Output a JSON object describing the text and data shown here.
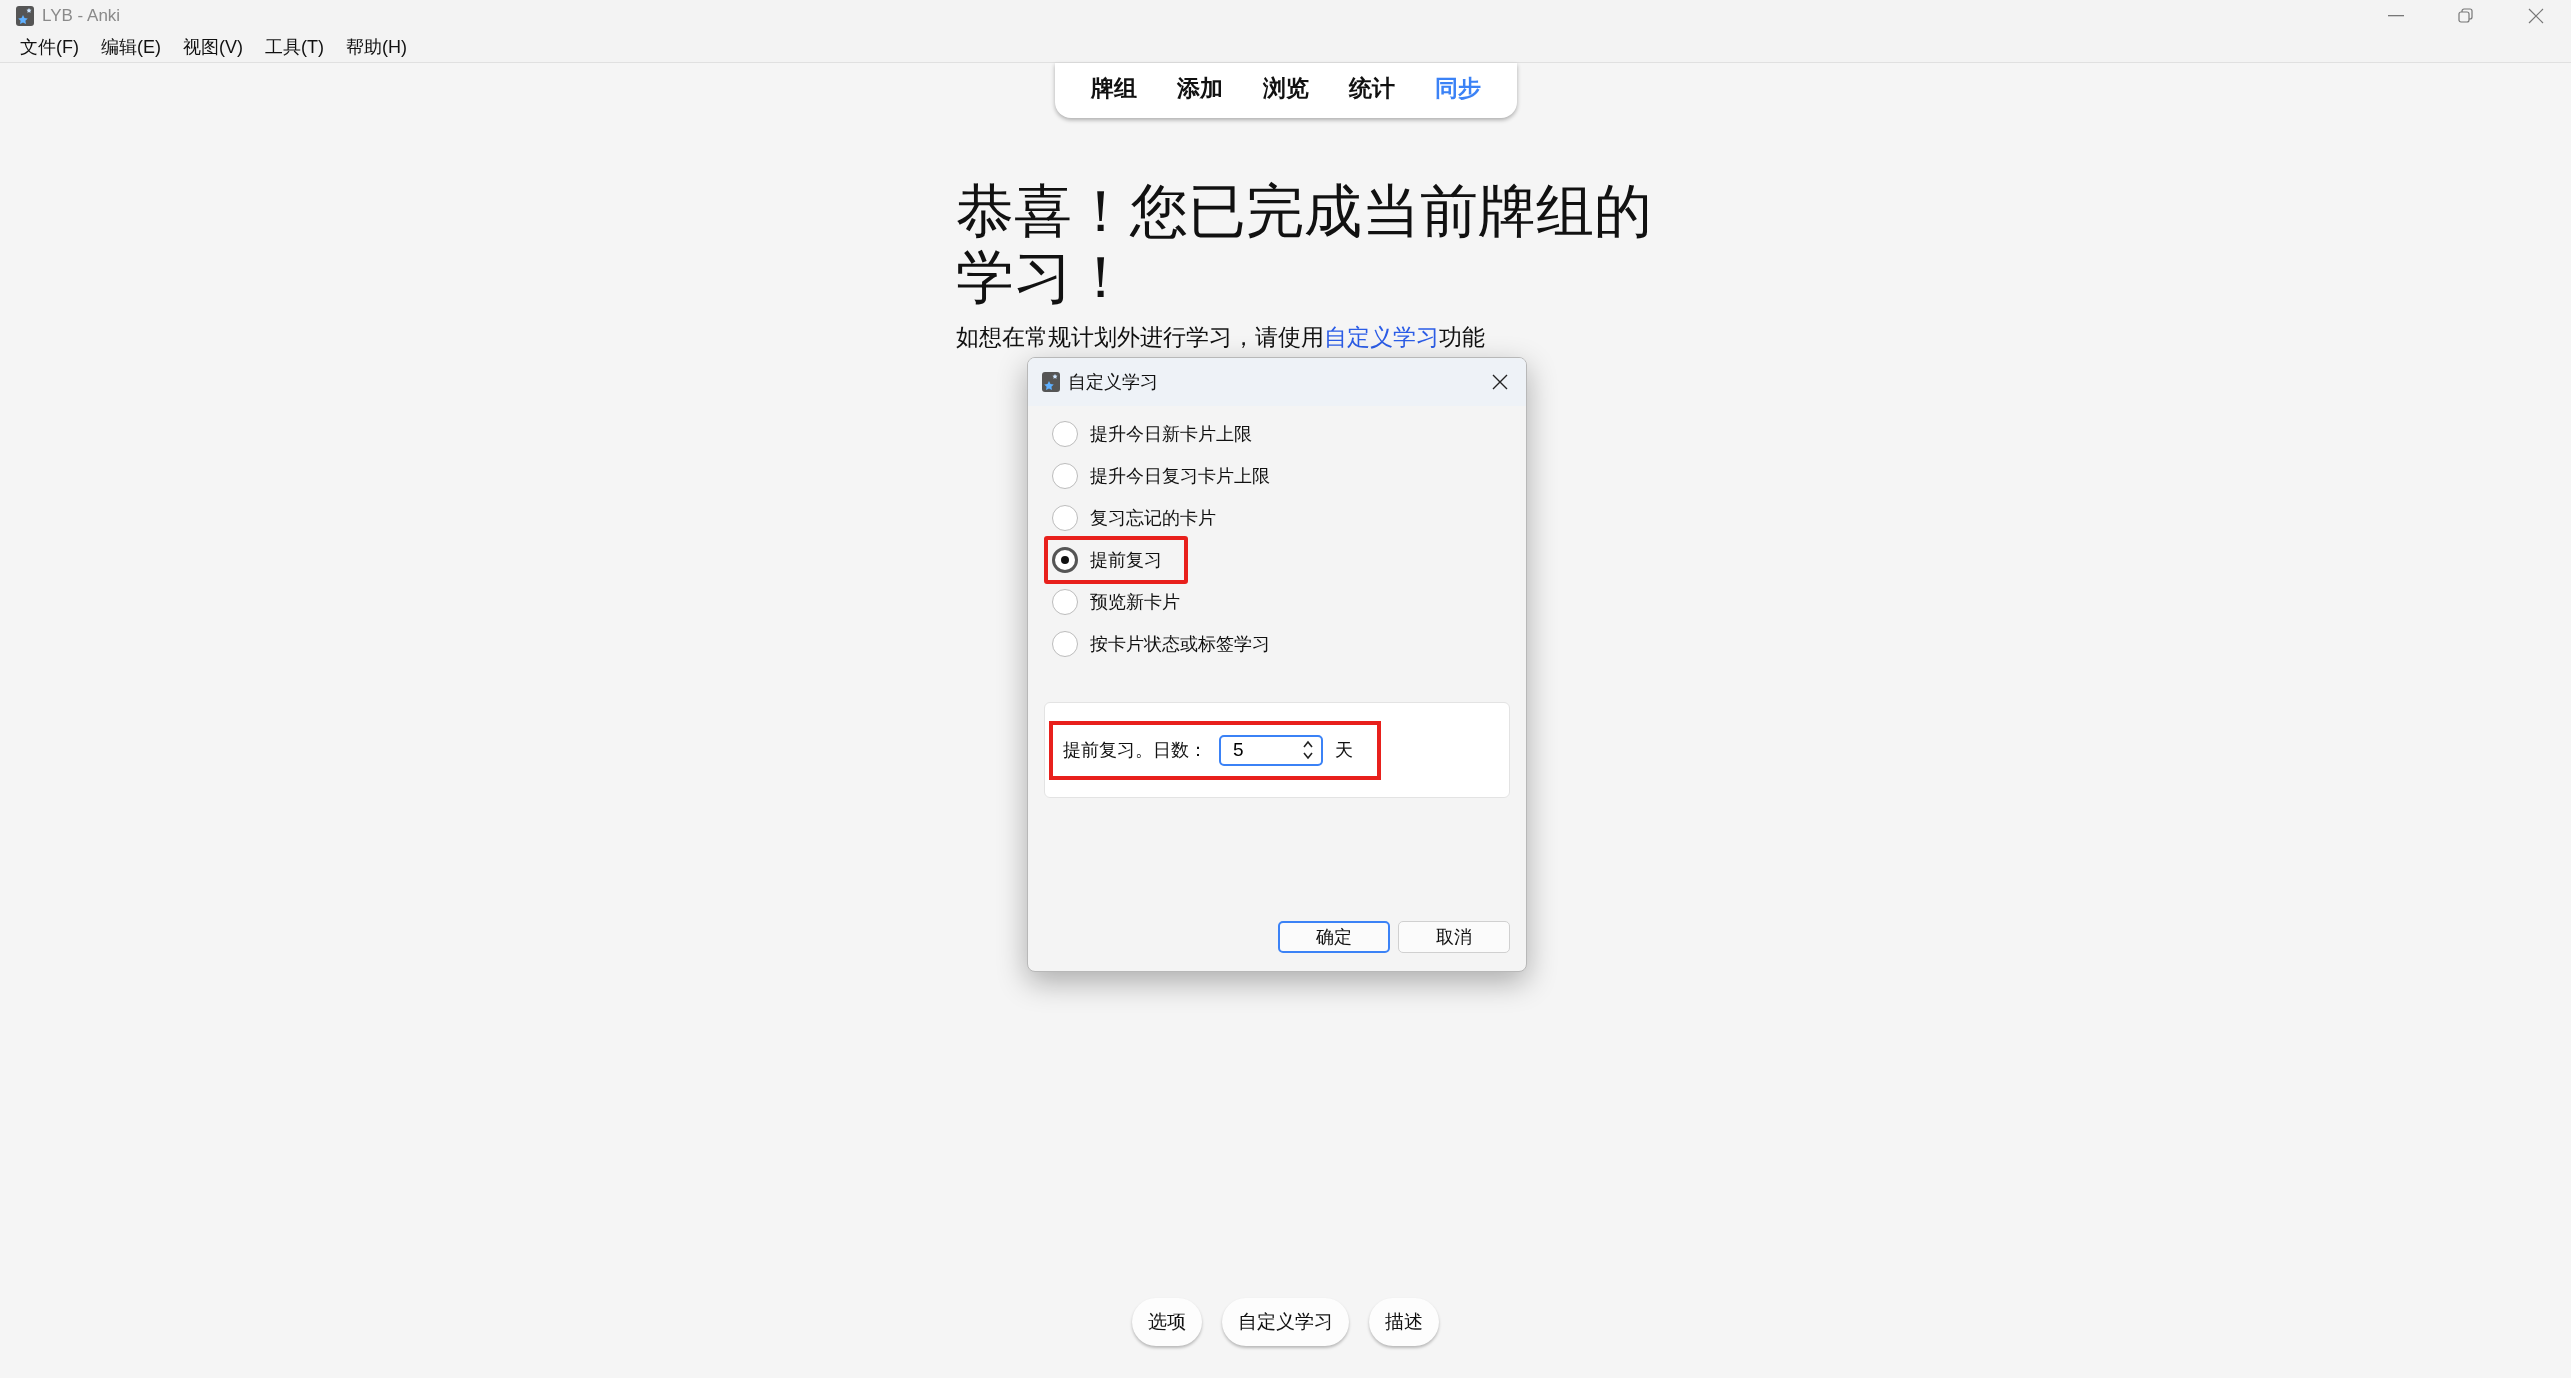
{
  "window": {
    "title": "LYB - Anki"
  },
  "menu": [
    "文件(F)",
    "编辑(E)",
    "视图(V)",
    "工具(T)",
    "帮助(H)"
  ],
  "tabs": [
    {
      "label": "牌组",
      "selected": false
    },
    {
      "label": "添加",
      "selected": false
    },
    {
      "label": "浏览",
      "selected": false
    },
    {
      "label": "统计",
      "selected": false
    },
    {
      "label": "同步",
      "selected": true
    }
  ],
  "heading": "恭喜！您已完成当前牌组的学习！",
  "hint": {
    "before": "如想在常规计划外进行学习，请使用",
    "link": "自定义学习",
    "after": "功能"
  },
  "dialog": {
    "title": "自定义学习",
    "options": [
      {
        "label": "提升今日新卡片上限",
        "selected": false,
        "highlighted": false
      },
      {
        "label": "提升今日复习卡片上限",
        "selected": false,
        "highlighted": false
      },
      {
        "label": "复习忘记的卡片",
        "selected": false,
        "highlighted": false
      },
      {
        "label": "提前复习",
        "selected": true,
        "highlighted": true
      },
      {
        "label": "预览新卡片",
        "selected": false,
        "highlighted": false
      },
      {
        "label": "按卡片状态或标签学习",
        "selected": false,
        "highlighted": false
      }
    ],
    "days": {
      "label": "提前复习。日数：",
      "value": "5",
      "unit": "天",
      "highlighted": true
    },
    "buttons": [
      {
        "label": "确定",
        "kind": "primary"
      },
      {
        "label": "取消",
        "kind": "normal"
      }
    ]
  },
  "bottom_buttons": [
    "选项",
    "自定义学习",
    "描述"
  ]
}
